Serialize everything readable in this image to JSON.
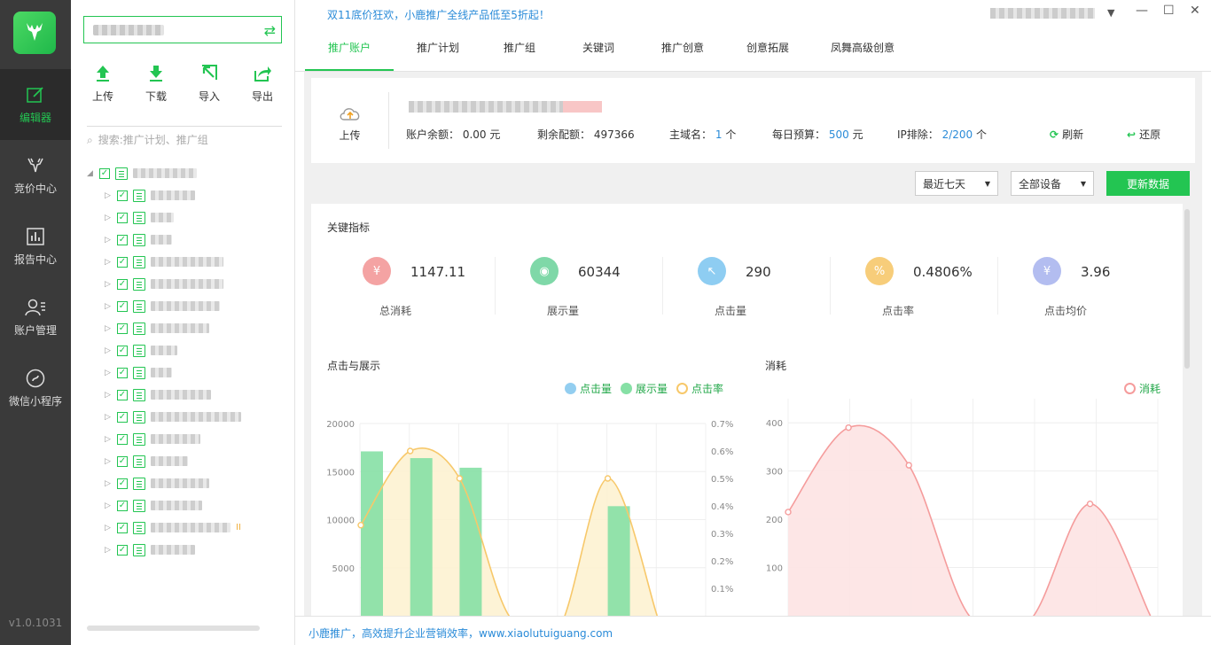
{
  "app": {
    "version": "v1.0.1031"
  },
  "nav": [
    {
      "label": "编辑器",
      "icon": "edit-icon",
      "active": true
    },
    {
      "label": "竞价中心",
      "icon": "deer-icon",
      "active": false
    },
    {
      "label": "报告中心",
      "icon": "report-icon",
      "active": false
    },
    {
      "label": "账户管理",
      "icon": "user-manage-icon",
      "active": false
    },
    {
      "label": "微信小程序",
      "icon": "mini-program-icon",
      "active": false
    }
  ],
  "tree_panel": {
    "tools": [
      {
        "label": "上传",
        "icon": "upload-icon"
      },
      {
        "label": "下载",
        "icon": "download-icon"
      },
      {
        "label": "导入",
        "icon": "import-icon"
      },
      {
        "label": "导出",
        "icon": "export-icon"
      }
    ],
    "search_placeholder": "搜索:推广计划、推广组"
  },
  "header": {
    "promo": "双11底价狂欢，小鹿推广全线产品低至5折起！",
    "tabs": [
      "推广账户",
      "推广计划",
      "推广组",
      "关键词",
      "推广创意",
      "创意拓展",
      "凤舞高级创意"
    ],
    "active_tab": 0
  },
  "account": {
    "upload_label": "上传",
    "balance_label": "账户余额：",
    "balance_value": "0.00",
    "balance_unit": "元",
    "quota_label": "剩余配额：",
    "quota_value": "497366",
    "domain_label": "主域名：",
    "domain_value": "1",
    "domain_unit": "个",
    "budget_label": "每日预算：",
    "budget_value": "500",
    "budget_unit": "元",
    "ip_label": "IP排除：",
    "ip_value": "2/200",
    "ip_unit": "个",
    "refresh_label": "刷新",
    "restore_label": "还原"
  },
  "filters": {
    "period": "最近七天",
    "device": "全部设备",
    "update_button": "更新数据"
  },
  "metrics": {
    "title": "关键指标",
    "items": [
      {
        "label": "总消耗",
        "value": "1147.11",
        "icon": "yuan-icon",
        "color": "#f4a3a3",
        "glyph": "¥"
      },
      {
        "label": "展示量",
        "value": "60344",
        "icon": "eye-icon",
        "color": "#7fd8a8",
        "glyph": "◉"
      },
      {
        "label": "点击量",
        "value": "290",
        "icon": "cursor-icon",
        "color": "#8ecdf2",
        "glyph": "↖"
      },
      {
        "label": "点击率",
        "value": "0.4806%",
        "icon": "percent-icon",
        "color": "#f7cd7a",
        "glyph": "%"
      },
      {
        "label": "点击均价",
        "value": "3.96",
        "icon": "avg-price-icon",
        "color": "#b3bdf0",
        "glyph": "¥"
      }
    ]
  },
  "chart_data": [
    {
      "type": "bar",
      "title": "点击与展示",
      "series": [
        {
          "name": "点击量",
          "kind": "bar",
          "color": "#93cef0",
          "values": [
            null,
            0,
            0,
            0,
            0,
            0,
            null
          ]
        },
        {
          "name": "展示量",
          "kind": "bar",
          "color": "#86e0a5",
          "values": [
            17100,
            16400,
            15400,
            0,
            0,
            11400,
            null
          ]
        },
        {
          "name": "点击率",
          "kind": "line",
          "axis": "right",
          "color": "#f7c86a",
          "values": [
            0.33,
            0.6,
            0.5,
            0,
            -0.05,
            0.5,
            0
          ]
        }
      ],
      "ylim": [
        0,
        20000
      ],
      "yticks": [
        5000,
        10000,
        15000,
        20000
      ],
      "y2lim": [
        0,
        0.7
      ],
      "y2ticks": [
        "0.1%",
        "0.2%",
        "0.3%",
        "0.4%",
        "0.5%",
        "0.6%",
        "0.7%"
      ],
      "legend": "top-right"
    },
    {
      "type": "area",
      "title": "消耗",
      "series": [
        {
          "name": "消耗",
          "color": "#f59c9c",
          "values": [
            215,
            390,
            312,
            0,
            -10,
            232,
            0
          ]
        }
      ],
      "ylim": [
        0,
        450
      ],
      "yticks": [
        100,
        200,
        300,
        400
      ],
      "legend": "top-right"
    }
  ],
  "footer": {
    "text": "小鹿推广，高效提升企业营销效率，www.xiaolutuiguang.com"
  }
}
